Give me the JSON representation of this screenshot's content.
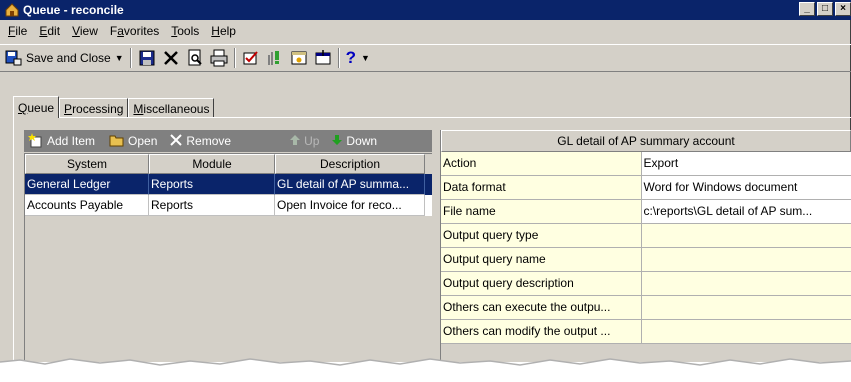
{
  "window": {
    "title": "Queue - reconcile",
    "controls": [
      "_",
      "□",
      "×"
    ]
  },
  "menu": [
    {
      "label": "File",
      "key": "F",
      "rest": "ile"
    },
    {
      "label": "Edit",
      "key": "E",
      "rest": "dit"
    },
    {
      "label": "View",
      "key": "V",
      "rest": "iew"
    },
    {
      "label": "Favorites",
      "pre": "F",
      "key": "a",
      "rest": "vorites"
    },
    {
      "label": "Tools",
      "key": "T",
      "rest": "ools"
    },
    {
      "label": "Help",
      "key": "H",
      "rest": "elp"
    }
  ],
  "toolbar": {
    "save_close_label": "Save and Close",
    "help_glyph": "?"
  },
  "tabs": [
    {
      "label": "Queue",
      "key": "Q",
      "rest": "ueue"
    },
    {
      "label": "Processing",
      "key": "P",
      "rest": "rocessing"
    },
    {
      "label": "Miscellaneous",
      "key": "M",
      "rest": "iscellaneous"
    }
  ],
  "queue_toolbar": {
    "add_item": "Add Item",
    "open": "Open",
    "remove": "Remove",
    "up": "Up",
    "down": "Down"
  },
  "queue_grid": {
    "columns": [
      "System",
      "Module",
      "Description"
    ],
    "rows": [
      {
        "system": "General Ledger",
        "module": "Reports",
        "description": "GL detail of AP summa...",
        "selected": true
      },
      {
        "system": "Accounts Payable",
        "module": "Reports",
        "description": "Open Invoice for reco...",
        "selected": false
      }
    ]
  },
  "properties": {
    "title": "GL detail of AP summary account",
    "rows": [
      {
        "name": "Action",
        "value": "Export"
      },
      {
        "name": "Data format",
        "value": "Word for Windows document"
      },
      {
        "name": "File name",
        "value": "c:\\reports\\GL detail of AP sum..."
      },
      {
        "name": "Output query type",
        "value": ""
      },
      {
        "name": "Output query name",
        "value": ""
      },
      {
        "name": "Output query description",
        "value": ""
      },
      {
        "name": "Others can execute the outpu...",
        "value": ""
      },
      {
        "name": "Others can modify the output ...",
        "value": ""
      }
    ]
  },
  "colors": {
    "titlebar": "#0a246a",
    "face": "#d4d0c8",
    "selection": "#0a246a",
    "property_name_bg": "#ffffe1",
    "pane_toolbar": "#808080"
  }
}
